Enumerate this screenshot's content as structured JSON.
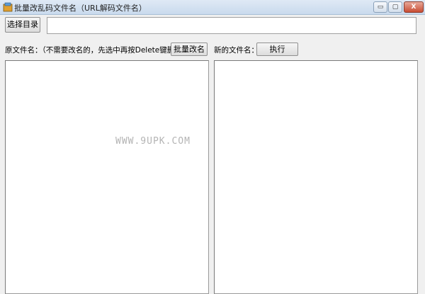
{
  "window": {
    "title": "批量改乱码文件名（URL解码文件名）",
    "controls": {
      "minimize": "▭",
      "maximize": "▢",
      "close": "X"
    }
  },
  "toolbar": {
    "select_dir_label": "选择目录",
    "path_value": ""
  },
  "labels": {
    "original_name": "原文件名：（不需要改名的，先选中再按Delete键删除）",
    "new_name": "新的文件名："
  },
  "buttons": {
    "batch_rename": "批量改名",
    "execute": "执行"
  },
  "watermark": "WWW.9UPK.COM",
  "icons": {
    "app": "app-icon"
  }
}
